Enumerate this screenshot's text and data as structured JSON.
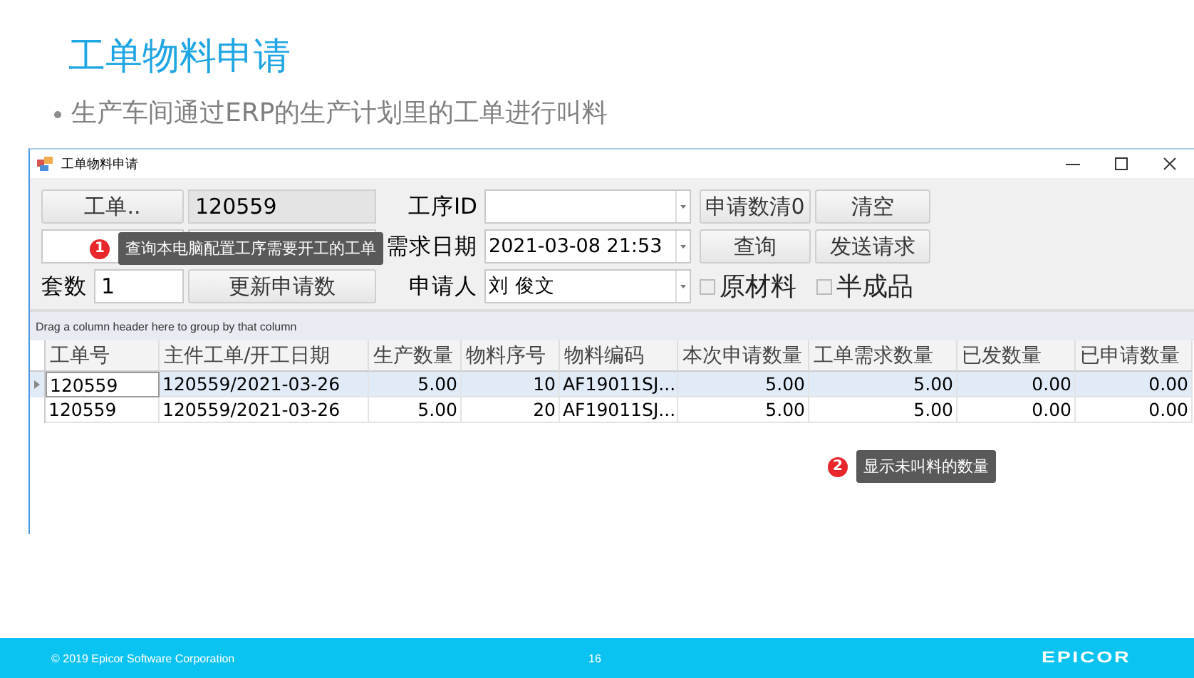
{
  "slide": {
    "title": "工单物料申请",
    "bullet": "生产车间通过ERP的生产计划里的工单进行叫料"
  },
  "window": {
    "title": "工单物料申请"
  },
  "form": {
    "order_button": "工单..",
    "order_no": "120559",
    "operation_label": "工序ID",
    "date_label": "需求日期",
    "date_value": "2021-03-08 21:53",
    "kit_label": "套数",
    "kit_value": "1",
    "update_button": "更新申请数",
    "applicant_label": "申请人",
    "applicant_value": "刘 俊文",
    "buttons": [
      "申请数清0",
      "清空",
      "查询",
      "发送请求"
    ],
    "checkboxes": [
      {
        "label": "原材料",
        "checked": false
      },
      {
        "label": "半成品",
        "checked": false
      }
    ]
  },
  "grid": {
    "group_hint": "Drag a column header here to group by that column",
    "columns": [
      "工单号",
      "主件工单/开工日期",
      "生产数量",
      "物料序号",
      "物料编码",
      "本次申请数量",
      "工单需求数量",
      "已发数量",
      "已申请数量"
    ],
    "rows": [
      {
        "selected": true,
        "cells": [
          "120559",
          "120559/2021-03-26",
          "5.00",
          "10",
          "AF19011SJ...",
          "5.00",
          "5.00",
          "0.00",
          "0.00"
        ]
      },
      {
        "selected": false,
        "cells": [
          "120559",
          "120559/2021-03-26",
          "5.00",
          "20",
          "AF19011SJ...",
          "5.00",
          "5.00",
          "0.00",
          "0.00"
        ]
      }
    ]
  },
  "callouts": [
    {
      "number": "1",
      "text": "查询本电脑配置工序需要开工的工单"
    },
    {
      "number": "2",
      "text": "显示未叫料的数量"
    }
  ],
  "footer": {
    "copyright": "© 2019 Epicor Software Corporation",
    "page": "16",
    "logo": "EPICOR"
  }
}
